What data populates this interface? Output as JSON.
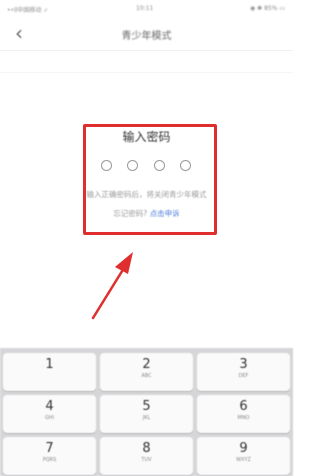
{
  "status_bar": {
    "carrier": "••ll中国移动 ✓",
    "time": "10:11",
    "battery": "◉ ✱ 85% ▭"
  },
  "nav": {
    "back_icon": "chevron-left-icon",
    "title": "青少年模式"
  },
  "dialog": {
    "title": "输入密码",
    "pin_length": 4,
    "hint": "输入正确密码后，将关闭青少年模式",
    "forgot_question": "忘记密码?",
    "forgot_link": "点击申诉"
  },
  "annotation": {
    "box_color": "#e02d2d",
    "arrow_color": "#e02d2d"
  },
  "keypad": {
    "keys": [
      {
        "digit": "1",
        "letters": ""
      },
      {
        "digit": "2",
        "letters": "ABC"
      },
      {
        "digit": "3",
        "letters": "DEF"
      },
      {
        "digit": "4",
        "letters": "GHI"
      },
      {
        "digit": "5",
        "letters": "JKL"
      },
      {
        "digit": "6",
        "letters": "MNO"
      },
      {
        "digit": "7",
        "letters": "PQRS"
      },
      {
        "digit": "8",
        "letters": "TUV"
      },
      {
        "digit": "9",
        "letters": "WXYZ"
      }
    ]
  }
}
